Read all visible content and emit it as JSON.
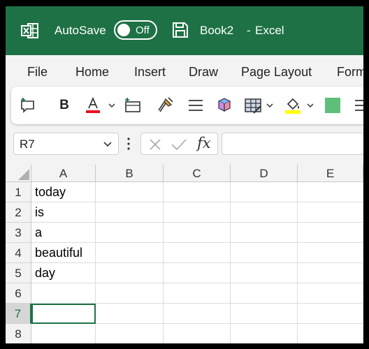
{
  "titlebar": {
    "autosave_label": "AutoSave",
    "autosave_state": "Off",
    "document_name": "Book2",
    "separator": "-",
    "app_name": "Excel",
    "color": "#1e7145"
  },
  "menu": {
    "tabs": [
      {
        "label": "File"
      },
      {
        "label": "Home"
      },
      {
        "label": "Insert"
      },
      {
        "label": "Draw"
      },
      {
        "label": "Page Layout"
      },
      {
        "label": "Form"
      }
    ]
  },
  "ribbon": {
    "bold_label": "B",
    "font_color": "#e81123",
    "highlight_color": "#ffff00",
    "fill_swatch_color": "#5fbf7a",
    "icons": [
      "new-comment-icon",
      "bold-icon",
      "font-color-icon",
      "insert-cells-icon",
      "format-painter-icon",
      "align-icon",
      "shapes-icon",
      "table-format-icon",
      "fill-color-icon",
      "color-swatch-icon",
      "wrap-text-icon"
    ]
  },
  "formula_bar": {
    "name_box": "R7",
    "fx_label": "fx",
    "formula": ""
  },
  "sheet": {
    "columns": [
      "A",
      "B",
      "C",
      "D",
      "E"
    ],
    "rows": [
      "1",
      "2",
      "3",
      "4",
      "5",
      "6",
      "7",
      "8"
    ],
    "cells_A": [
      "today",
      "is",
      "a",
      "beautiful",
      "day",
      "",
      "",
      ""
    ],
    "selected_row": "7",
    "selection_color": "#1e7145"
  }
}
